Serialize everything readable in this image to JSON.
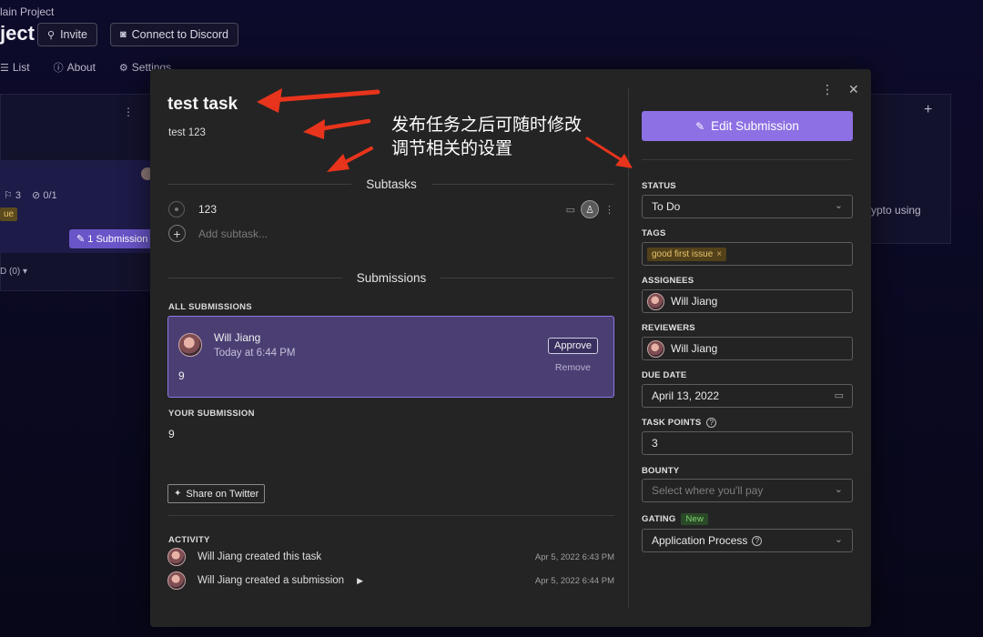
{
  "background": {
    "breadcrumb": "lain Project",
    "project_title": "ject",
    "invite_label": "Invite",
    "discord_label": "Connect to Discord",
    "tabs": [
      {
        "icon": "list-icon",
        "label": "List"
      },
      {
        "icon": "info-icon",
        "label": "About"
      },
      {
        "icon": "gear-icon",
        "label": "Settings"
      }
    ],
    "left_card": {
      "comments": "3",
      "subtasks": "0/1",
      "tag": "ue",
      "submission_chip": "1 Submission",
      "footer": "D (0)"
    },
    "right_column_text": "ypto using"
  },
  "task": {
    "title": "test task",
    "description": "test 123"
  },
  "subtasks": {
    "heading": "Subtasks",
    "items": [
      {
        "label": "123"
      }
    ],
    "add_placeholder": "Add subtask..."
  },
  "submissions": {
    "heading": "Submissions",
    "all_label": "ALL SUBMISSIONS",
    "card": {
      "author": "Will Jiang",
      "time": "Today at 6:44 PM",
      "value": "9",
      "approve_label": "Approve",
      "remove_label": "Remove"
    },
    "your_label": "YOUR SUBMISSION",
    "your_value": "9"
  },
  "share_twitter_label": "Share on Twitter",
  "activity": {
    "label": "ACTIVITY",
    "items": [
      {
        "text": "Will Jiang created this task",
        "time": "Apr 5, 2022 6:43 PM"
      },
      {
        "text": "Will Jiang created a submission",
        "time": "Apr 5, 2022 6:44 PM"
      }
    ]
  },
  "sidebar": {
    "edit_button": "Edit Submission",
    "status": {
      "label": "STATUS",
      "value": "To Do"
    },
    "tags": {
      "label": "TAGS",
      "chip": "good first issue"
    },
    "assignees": {
      "label": "ASSIGNEES",
      "value": "Will Jiang"
    },
    "reviewers": {
      "label": "REVIEWERS",
      "value": "Will Jiang"
    },
    "due_date": {
      "label": "DUE DATE",
      "value": "April 13, 2022"
    },
    "task_points": {
      "label": "TASK POINTS",
      "value": "3"
    },
    "bounty": {
      "label": "BOUNTY",
      "placeholder": "Select where you'll pay"
    },
    "gating": {
      "label": "GATING",
      "badge": "New",
      "value": "Application Process"
    }
  },
  "annotation": {
    "line1": "发布任务之后可随时修改",
    "line2": "调节相关的设置",
    "color": "#e8341c"
  },
  "colors": {
    "accent": "#8d70e3",
    "submission_card_bg": "#4a3e73",
    "modal_bg": "#242424",
    "page_bg": "#0b0a24"
  }
}
